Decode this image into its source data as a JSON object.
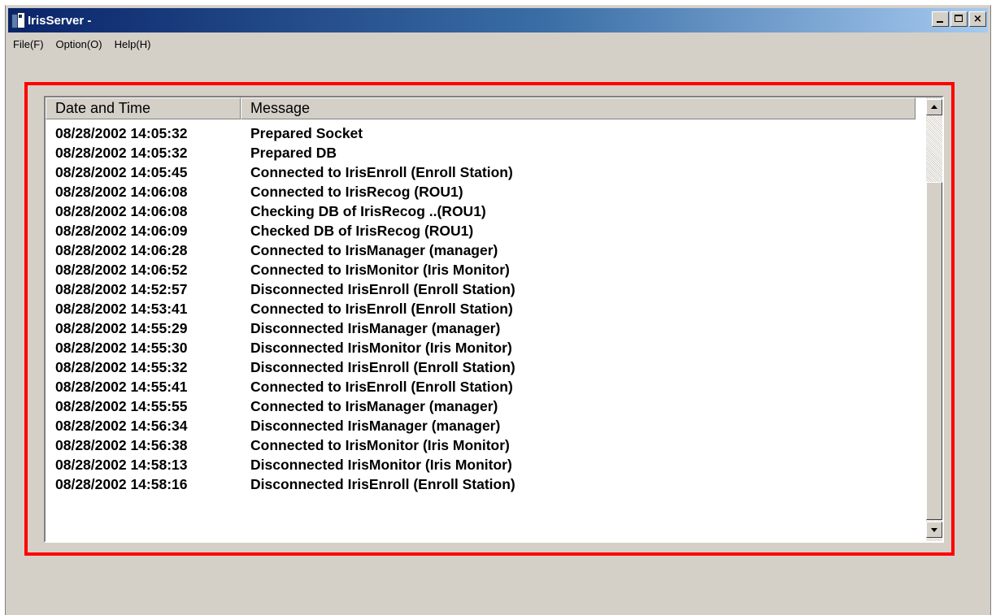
{
  "window": {
    "title": "IrisServer -",
    "minimize_icon": "minimize-icon",
    "maximize_icon": "maximize-icon",
    "close_label": "×"
  },
  "menu": {
    "items": [
      "File(F)",
      "Option(O)",
      "Help(H)"
    ]
  },
  "log": {
    "columns": {
      "date": "Date and Time",
      "message": "Message"
    },
    "rows": [
      {
        "date": "08/28/2002 14:05:32",
        "message": "Prepared Socket"
      },
      {
        "date": "08/28/2002 14:05:32",
        "message": "Prepared DB"
      },
      {
        "date": "08/28/2002 14:05:45",
        "message": "Connected to IrisEnroll (Enroll Station)"
      },
      {
        "date": "08/28/2002 14:06:08",
        "message": "Connected to IrisRecog (ROU1)"
      },
      {
        "date": "08/28/2002 14:06:08",
        "message": "Checking DB of IrisRecog ..(ROU1)"
      },
      {
        "date": "08/28/2002 14:06:09",
        "message": "Checked DB of IrisRecog (ROU1)"
      },
      {
        "date": "08/28/2002 14:06:28",
        "message": "Connected to IrisManager (manager)"
      },
      {
        "date": "08/28/2002 14:06:52",
        "message": "Connected to IrisMonitor (Iris Monitor)"
      },
      {
        "date": "08/28/2002 14:52:57",
        "message": "Disconnected IrisEnroll (Enroll Station)"
      },
      {
        "date": "08/28/2002 14:53:41",
        "message": "Connected to IrisEnroll (Enroll Station)"
      },
      {
        "date": "08/28/2002 14:55:29",
        "message": "Disconnected IrisManager (manager)"
      },
      {
        "date": "08/28/2002 14:55:30",
        "message": "Disconnected IrisMonitor (Iris Monitor)"
      },
      {
        "date": "08/28/2002 14:55:32",
        "message": "Disconnected IrisEnroll (Enroll Station)"
      },
      {
        "date": "08/28/2002 14:55:41",
        "message": "Connected to IrisEnroll (Enroll Station)"
      },
      {
        "date": "08/28/2002 14:55:55",
        "message": "Connected to IrisManager (manager)"
      },
      {
        "date": "08/28/2002 14:56:34",
        "message": "Disconnected IrisManager (manager)"
      },
      {
        "date": "08/28/2002 14:56:38",
        "message": "Connected to IrisMonitor (Iris Monitor)"
      },
      {
        "date": "08/28/2002 14:58:13",
        "message": "Disconnected IrisMonitor (Iris Monitor)"
      },
      {
        "date": "08/28/2002 14:58:16",
        "message": "Disconnected IrisEnroll (Enroll Station)"
      }
    ]
  },
  "colors": {
    "highlight_frame": "#ff0000",
    "titlebar_start": "#0a246a",
    "titlebar_end": "#a6caf0"
  }
}
